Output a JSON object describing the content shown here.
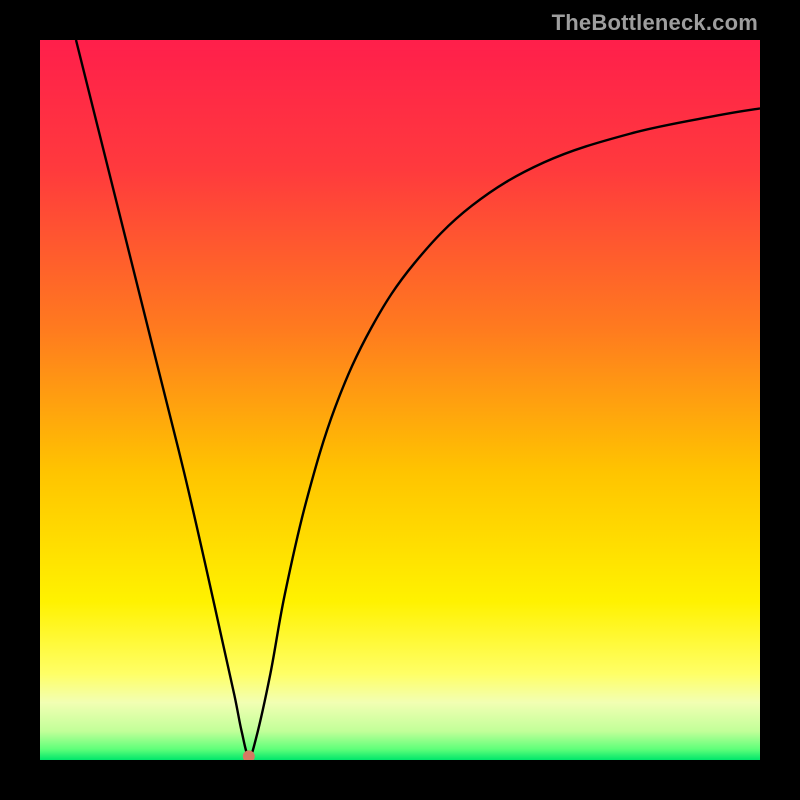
{
  "watermark": "TheBottleneck.com",
  "chart_data": {
    "type": "line",
    "title": "",
    "xlabel": "",
    "ylabel": "",
    "xlim": [
      0,
      100
    ],
    "ylim": [
      0,
      100
    ],
    "grid": false,
    "legend": false,
    "gradient_stops": [
      {
        "offset": 0.0,
        "color": "#ff1f4b"
      },
      {
        "offset": 0.18,
        "color": "#ff3a3d"
      },
      {
        "offset": 0.4,
        "color": "#ff7a1f"
      },
      {
        "offset": 0.6,
        "color": "#ffc400"
      },
      {
        "offset": 0.78,
        "color": "#fff200"
      },
      {
        "offset": 0.88,
        "color": "#ffff66"
      },
      {
        "offset": 0.92,
        "color": "#f2ffb3"
      },
      {
        "offset": 0.96,
        "color": "#c2ff99"
      },
      {
        "offset": 0.985,
        "color": "#5fff7a"
      },
      {
        "offset": 1.0,
        "color": "#00e66b"
      }
    ],
    "marker": {
      "x": 29,
      "y": 0.5,
      "color": "#d47a62",
      "radius_px": 6
    },
    "series": [
      {
        "name": "bottleneck-curve",
        "x": [
          5,
          8,
          12,
          16,
          20,
          23,
          25,
          27,
          28,
          29,
          30,
          32,
          34,
          37,
          41,
          46,
          52,
          60,
          70,
          82,
          94,
          100
        ],
        "y": [
          100,
          88,
          72,
          56,
          40,
          27,
          18,
          9,
          4,
          0.5,
          3,
          12,
          23,
          36,
          49,
          60,
          69,
          77,
          83,
          87,
          89.5,
          90.5
        ]
      }
    ]
  }
}
